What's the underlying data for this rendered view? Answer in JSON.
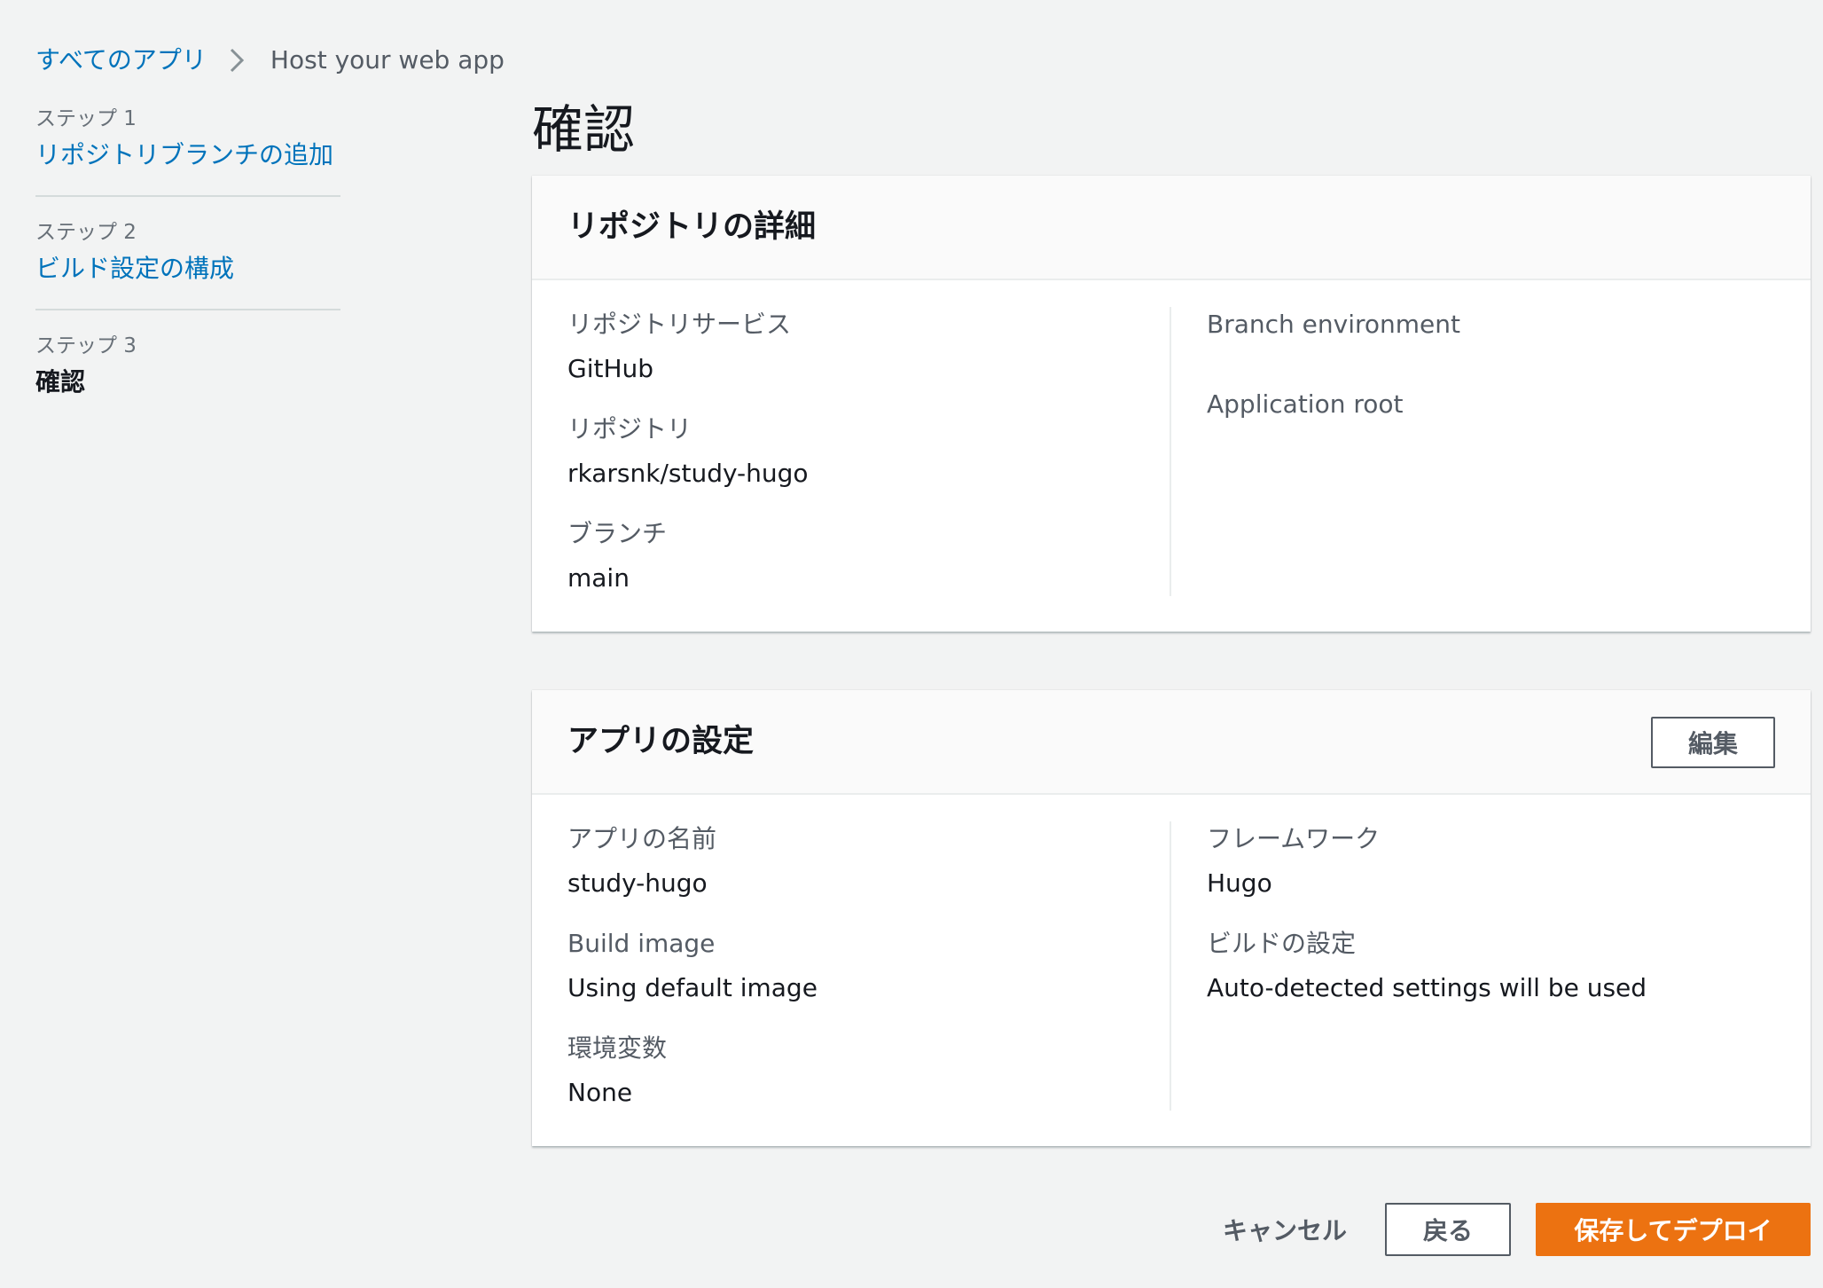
{
  "breadcrumb": {
    "root": "すべてのアプリ",
    "current": "Host your web app"
  },
  "steps": [
    {
      "label": "ステップ 1",
      "title": "リポジトリブランチの追加"
    },
    {
      "label": "ステップ 2",
      "title": "ビルド設定の構成"
    },
    {
      "label": "ステップ 3",
      "title": "確認"
    }
  ],
  "page": {
    "title": "確認"
  },
  "repo_panel": {
    "title": "リポジトリの詳細",
    "left": [
      {
        "key": "リポジトリサービス",
        "value": "GitHub"
      },
      {
        "key": "リポジトリ",
        "value": "rkarsnk/study-hugo"
      },
      {
        "key": "ブランチ",
        "value": "main"
      }
    ],
    "right": [
      {
        "key": "Branch environment",
        "value": ""
      },
      {
        "key": "Application root",
        "value": ""
      }
    ]
  },
  "app_panel": {
    "title": "アプリの設定",
    "edit_label": "編集",
    "left": [
      {
        "key": "アプリの名前",
        "value": "study-hugo"
      },
      {
        "key": "Build image",
        "value": "Using default image"
      },
      {
        "key": "環境変数",
        "value": "None"
      }
    ],
    "right": [
      {
        "key": "フレームワーク",
        "value": "Hugo"
      },
      {
        "key": "ビルドの設定",
        "value": "Auto-detected settings will be used"
      }
    ]
  },
  "footer": {
    "cancel_label": "キャンセル",
    "back_label": "戻る",
    "deploy_label": "保存してデプロイ"
  },
  "colors": {
    "background": "#f2f3f3",
    "link": "#0073bb",
    "primary": "#ec7211",
    "text": "#16191f",
    "secondary_text": "#545b64"
  },
  "icons": {
    "breadcrumb_separator": "chevron-right-icon"
  }
}
